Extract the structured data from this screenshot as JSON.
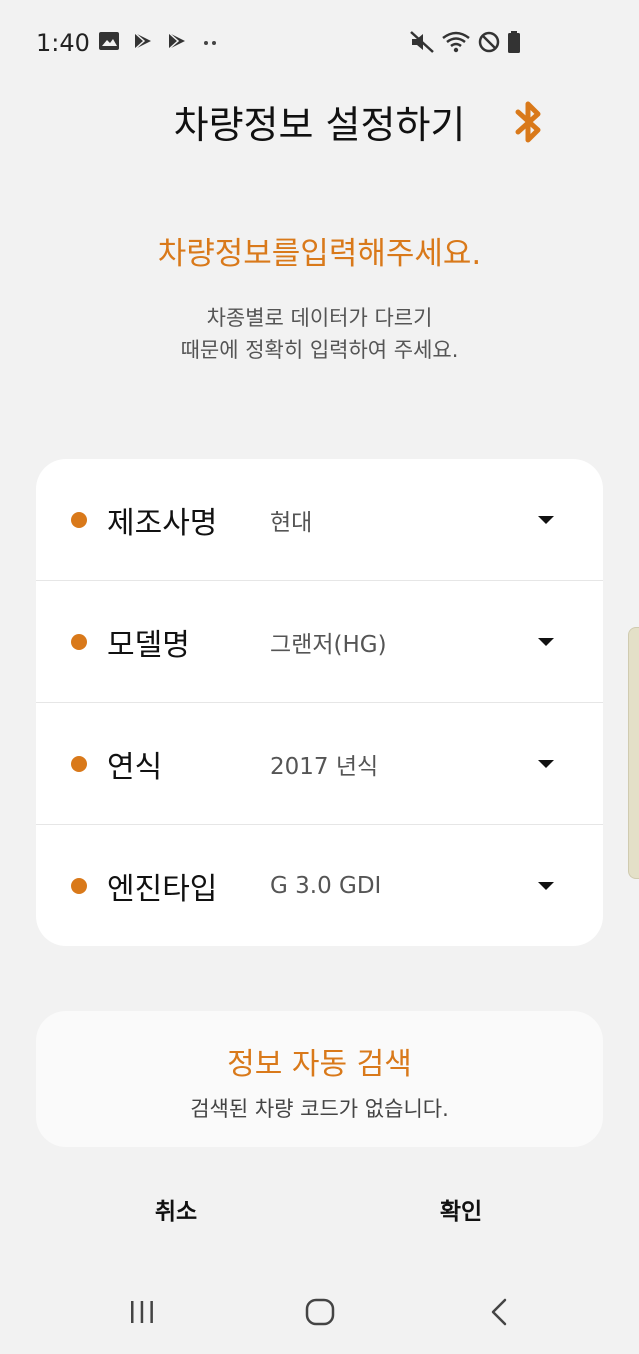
{
  "status_bar": {
    "time": "1:40",
    "left_icons": [
      "gallery-icon",
      "play-store-icon",
      "play-store-icon",
      "more-dots-icon"
    ],
    "right_icons": [
      "mute-icon",
      "wifi-icon",
      "do-not-disturb-icon",
      "battery-icon"
    ]
  },
  "header": {
    "title": "차량정보 설정하기",
    "icon": "bluetooth-icon"
  },
  "intro": {
    "headline": "차량정보를입력해주세요.",
    "line1": "차종별로 데이터가 다르기",
    "line2": "때문에 정확히 입력하여 주세요."
  },
  "form": {
    "rows": [
      {
        "label": "제조사명",
        "value": "현대"
      },
      {
        "label": "모델명",
        "value": "그랜저(HG)"
      },
      {
        "label": "연식",
        "value": "2017 년식"
      },
      {
        "label": "엔진타입",
        "value": "G 3.0 GDI"
      }
    ]
  },
  "auto_search": {
    "title": "정보 자동 검색",
    "subtitle": "검색된 차량 코드가 없습니다."
  },
  "actions": {
    "cancel": "취소",
    "confirm": "확인"
  },
  "nav_bar": {
    "icons": [
      "recent-apps-icon",
      "home-icon",
      "back-icon"
    ]
  },
  "colors": {
    "accent": "#d9791a",
    "background": "#f2f2f2",
    "card": "#ffffff"
  }
}
